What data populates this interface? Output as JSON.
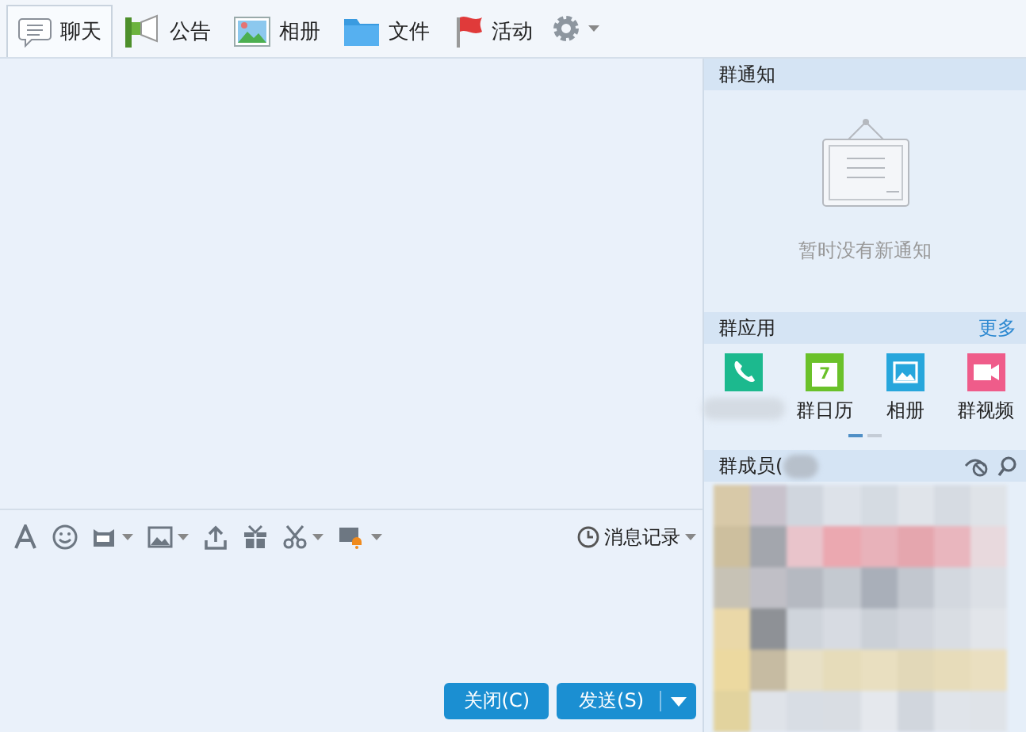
{
  "toolbar": {
    "tabs": [
      {
        "label": "聊天",
        "kind": "chat",
        "selected": true
      },
      {
        "label": "公告",
        "kind": "megaphone",
        "selected": false
      },
      {
        "label": "相册",
        "kind": "picture",
        "selected": false
      },
      {
        "label": "文件",
        "kind": "folder",
        "selected": false
      },
      {
        "label": "活动",
        "kind": "flag",
        "selected": false
      }
    ]
  },
  "input_toolbar": {
    "history": "消息记录"
  },
  "buttons": {
    "close": "关闭(C)",
    "send": "发送(S)"
  },
  "notice": {
    "title": "群通知",
    "empty_text": "暂时没有新通知"
  },
  "apps": {
    "title": "群应用",
    "more": "更多",
    "items": [
      {
        "kind": "phone"
      },
      {
        "kind": "calendar",
        "label": "群日历",
        "icon_text": "7"
      },
      {
        "kind": "picture",
        "label": "相册"
      },
      {
        "kind": "video",
        "label": "群视频"
      }
    ],
    "pages": [
      {
        "selected": true
      },
      {
        "selected": false
      }
    ]
  },
  "members": {
    "title": "群成员("
  }
}
